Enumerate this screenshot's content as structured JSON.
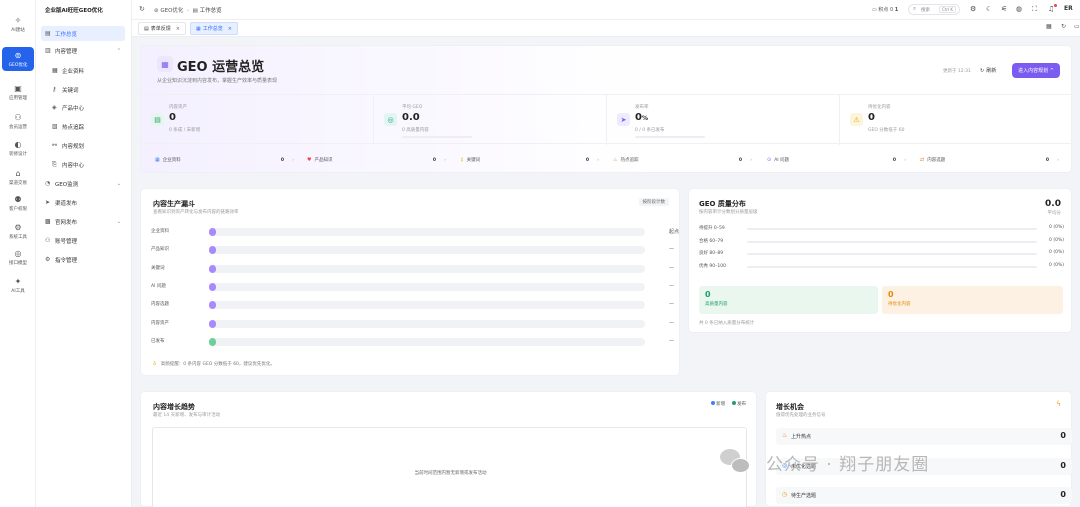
{
  "rail": [
    {
      "label": "AI建站",
      "icon": "magic-wand-icon",
      "glyph": "✧"
    },
    {
      "label": "GEO优化",
      "icon": "geo-icon",
      "glyph": "⊚",
      "active": true
    },
    {
      "label": "应用管理",
      "icon": "apps-icon",
      "glyph": "▣"
    },
    {
      "label": "会员运营",
      "icon": "members-icon",
      "glyph": "⚇"
    },
    {
      "label": "装修设计",
      "icon": "design-icon",
      "glyph": "◐"
    },
    {
      "label": "渠道交易",
      "icon": "shop-icon",
      "glyph": "⌂"
    },
    {
      "label": "客户权限",
      "icon": "customer-icon",
      "glyph": "⚉"
    },
    {
      "label": "系统工具",
      "icon": "tools-icon",
      "glyph": "⚙"
    },
    {
      "label": "接口模型",
      "icon": "model-icon",
      "glyph": "◎"
    },
    {
      "label": "AI工具",
      "icon": "ai-tools-icon",
      "glyph": "✦"
    }
  ],
  "menu": {
    "brand": "企业版AI旺旺GEO优化",
    "items": [
      {
        "label": "工作总览",
        "icon": "overview-icon",
        "glyph": "▤",
        "type": "top",
        "active": true
      },
      {
        "label": "内容管理",
        "icon": "content-icon",
        "glyph": "▥",
        "type": "top",
        "expand": "⌃"
      },
      {
        "label": "企业资料",
        "icon": "company-icon",
        "glyph": "▦",
        "type": "sub"
      },
      {
        "label": "关键词",
        "icon": "keyword-icon",
        "glyph": "⚷",
        "type": "sub"
      },
      {
        "label": "产品中心",
        "icon": "product-icon",
        "glyph": "◈",
        "type": "sub"
      },
      {
        "label": "热点追踪",
        "icon": "hot-icon",
        "glyph": "▧",
        "type": "sub"
      },
      {
        "label": "内容规划",
        "icon": "plan-icon",
        "glyph": "⚯",
        "type": "sub"
      },
      {
        "label": "内容中心",
        "icon": "content-center-icon",
        "glyph": "⎘",
        "type": "sub"
      },
      {
        "label": "GEO监测",
        "icon": "monitor-icon",
        "glyph": "◔",
        "type": "top",
        "expand": "⌄"
      },
      {
        "label": "渠道发布",
        "icon": "publish-icon",
        "glyph": "➤",
        "type": "top"
      },
      {
        "label": "官网发布",
        "icon": "site-icon",
        "glyph": "▩",
        "type": "top",
        "expand": "⌄"
      },
      {
        "label": "账号管理",
        "icon": "account-icon",
        "glyph": "⚇",
        "type": "top"
      },
      {
        "label": "指令管理",
        "icon": "command-icon",
        "glyph": "⚙",
        "type": "top"
      }
    ]
  },
  "topbar": {
    "breadcrumb": [
      "GEO优化",
      "工作总览"
    ],
    "points_label": "积点",
    "points_value": "0",
    "points_extra": "1",
    "search_placeholder": "搜索",
    "search_shortcut": "Ctrl K",
    "avatar": "ER"
  },
  "tabs": [
    {
      "label": "表单反馈",
      "active": false
    },
    {
      "label": "工作总览",
      "active": true
    }
  ],
  "header": {
    "title": "GEO 运营总览",
    "subtitle": "从企业知识沉淀到内容发布，掌握生产效率与质量表现",
    "updated": "更新于 12:31",
    "refresh_label": "刷新",
    "primary_btn": "进入内容规划 ^"
  },
  "stats": [
    {
      "label": "内容资产",
      "value": "0",
      "sub": "0 条成 / 未新增",
      "icon": "doc-icon",
      "glyph": "▤",
      "color": "#22a06b",
      "bg": "#e6f6ee"
    },
    {
      "label": "平均 GEO",
      "value": "0.0",
      "sub": "0 高质量内容",
      "icon": "geo-score-icon",
      "glyph": "◎",
      "color": "#1aa39a",
      "bg": "#e3f5f3",
      "progress": 0
    },
    {
      "label": "发布率",
      "value": "0",
      "unit": "%",
      "sub": "0 / 0 条已发布",
      "icon": "send-icon",
      "glyph": "➤",
      "color": "#7c5cf0",
      "bg": "#efeafe",
      "progress": 0
    },
    {
      "label": "待优化内容",
      "value": "0",
      "sub": "GEO 分数低于 60",
      "icon": "warning-icon",
      "glyph": "⚠",
      "color": "#e0a100",
      "bg": "#fdf4dc"
    }
  ],
  "quick": [
    {
      "label": "企业资料",
      "value": "0",
      "icon": "db-icon",
      "glyph": "▦",
      "color": "#3b82f6"
    },
    {
      "label": "产品知识",
      "value": "0",
      "icon": "heart-icon",
      "glyph": "♥",
      "color": "#ef4444"
    },
    {
      "label": "关键词",
      "value": "0",
      "icon": "key-icon",
      "glyph": "⚷",
      "color": "#eab308"
    },
    {
      "label": "热点追踪",
      "value": "0",
      "icon": "fire-icon",
      "glyph": "♨",
      "color": "#f97316"
    },
    {
      "label": "AI 问题",
      "value": "0",
      "icon": "ai-question-icon",
      "glyph": "⊙",
      "color": "#7c5cf0"
    },
    {
      "label": "内容选题",
      "value": "0",
      "icon": "topic-icon",
      "glyph": "⇄",
      "color": "#f97316"
    }
  ],
  "funnel": {
    "title": "内容生产漏斗",
    "subtitle": "查看知识到资产转化与发布内容的链路效率",
    "badge": "按阶段计数",
    "rows": [
      {
        "label": "企业资料",
        "value": "起点",
        "color": "#a78bfa"
      },
      {
        "label": "产品知识",
        "value": "—",
        "color": "#a78bfa"
      },
      {
        "label": "关键词",
        "value": "—",
        "color": "#a78bfa"
      },
      {
        "label": "AI 问题",
        "value": "—",
        "color": "#a78bfa"
      },
      {
        "label": "内容选题",
        "value": "—",
        "color": "#a78bfa"
      },
      {
        "label": "内容资产",
        "value": "—",
        "color": "#a78bfa"
      },
      {
        "label": "已发布",
        "value": "—",
        "color": "#6ecf9a"
      }
    ],
    "hint": "高频提醒：0 条内容 GEO 分数低于 60，建议优先优化。"
  },
  "distribution": {
    "title": "GEO 质量分布",
    "subtitle": "按内容审计分数划分质量层级",
    "avg_value": "0.0",
    "avg_label": "平均分",
    "rows": [
      {
        "label": "待提升 0–59",
        "value": "0 (0%)",
        "fraction": 0
      },
      {
        "label": "合格 60–79",
        "value": "0 (0%)",
        "fraction": 0
      },
      {
        "label": "良好 80–89",
        "value": "0 (0%)",
        "fraction": 0
      },
      {
        "label": "优秀 90–100",
        "value": "0 (0%)",
        "fraction": 0
      }
    ],
    "boxes": [
      {
        "value": "0",
        "label": "高质量内容",
        "color": "#22a06b",
        "bg": "#e9f7ef"
      },
      {
        "value": "0",
        "label": "待优化内容",
        "color": "#e08a00",
        "bg": "#fdf1e3"
      }
    ],
    "footnote": "共 0 条已纳入质量分布统计"
  },
  "trend": {
    "title": "内容增长趋势",
    "subtitle": "最近 14 天新增、发布与审计活动",
    "legend": [
      {
        "label": "新增",
        "color": "#3b82f6"
      },
      {
        "label": "发布",
        "color": "#22a06b"
      }
    ],
    "empty": "当前时间范围内暂无新增或发布活动"
  },
  "growth": {
    "title": "增长机会",
    "subtitle": "值得优先处理的业务信号",
    "rows": [
      {
        "label": "上升热点",
        "value": "0",
        "icon": "flame-icon",
        "glyph": "♨",
        "color": "#f97316"
      },
      {
        "label": "未优化选题",
        "value": "0",
        "icon": "topic-icon",
        "glyph": "◎",
        "color": "#3b82f6"
      },
      {
        "label": "待生产选题",
        "value": "0",
        "icon": "clock-icon",
        "glyph": "◷",
        "color": "#f59e0b"
      }
    ]
  },
  "watermark": "公众号 · 翔子朋友圈"
}
